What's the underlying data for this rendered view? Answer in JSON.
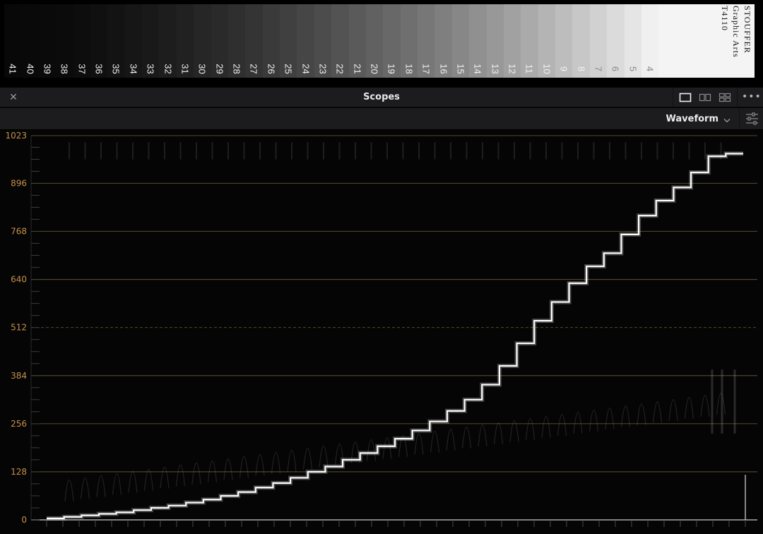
{
  "step_wedge": {
    "steps": [
      "41",
      "40",
      "39",
      "38",
      "37",
      "36",
      "35",
      "34",
      "33",
      "32",
      "31",
      "30",
      "29",
      "28",
      "27",
      "26",
      "25",
      "24",
      "23",
      "22",
      "21",
      "20",
      "19",
      "18",
      "17",
      "16",
      "15",
      "14",
      "13",
      "12",
      "11",
      "10",
      "9",
      "8",
      "7",
      "6",
      "5",
      "4"
    ],
    "brand_lines": [
      "STOUFFER",
      "Graphic Arts",
      "T4110"
    ]
  },
  "panel": {
    "title": "Scopes",
    "close_icon": "close-icon",
    "layout_icons": [
      "layout-single-icon",
      "layout-dual-icon",
      "layout-quad-icon"
    ],
    "more_icon": "more-options-icon"
  },
  "toolbar": {
    "scope_type": "Waveform",
    "settings_icon": "sliders-settings-icon"
  },
  "scope": {
    "y_ticks": [
      "1023",
      "896",
      "768",
      "640",
      "512",
      "384",
      "256",
      "128",
      "0"
    ],
    "grid_color": "#6e5f3a",
    "label_color": "#c8914a",
    "trace_color": "#ffffff",
    "trace_levels": [
      4,
      8,
      12,
      16,
      20,
      26,
      32,
      38,
      46,
      54,
      64,
      74,
      86,
      98,
      112,
      128,
      142,
      160,
      178,
      196,
      216,
      238,
      262,
      290,
      320,
      360,
      410,
      470,
      530,
      580,
      630,
      675,
      710,
      760,
      810,
      850,
      885,
      925,
      968,
      975
    ]
  }
}
